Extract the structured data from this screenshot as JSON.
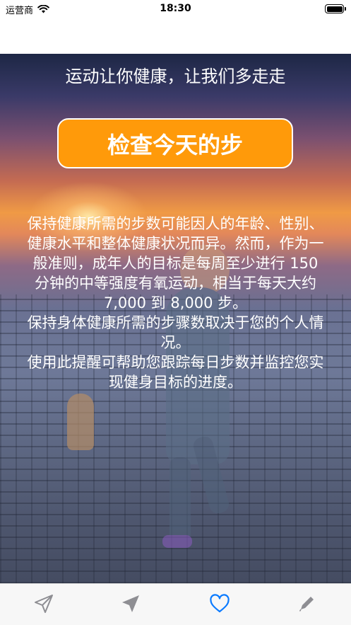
{
  "status_bar": {
    "carrier": "运营商",
    "time": "18:30"
  },
  "main": {
    "headline": "运动让你健康，让我们多走走",
    "check_button_label": "检查今天的步",
    "info_paragraphs": [
      "保持健康所需的步数可能因人的年龄、性别、健康水平和整体健康状况而异。然而，作为一般准则，成年人的目标是每周至少进行 150 分钟的中等强度有氧运动，相当于每天大约 7,000 到 8,000 步。",
      "保持身体健康所需的步骤数取决于您的个人情况。",
      "使用此提醒可帮助您跟踪每日步数并监控您实现健身目标的进度。"
    ]
  },
  "tab_bar": {
    "items": [
      {
        "icon": "paper-plane-outline-icon",
        "active": false
      },
      {
        "icon": "paper-plane-filled-icon",
        "active": false
      },
      {
        "icon": "heart-icon",
        "active": true
      },
      {
        "icon": "pencil-icon",
        "active": false
      }
    ],
    "active_color": "#0a7aff",
    "inactive_color": "#8e8e93"
  },
  "colors": {
    "button_background": "#ff9a0a",
    "text": "#ffffff"
  }
}
